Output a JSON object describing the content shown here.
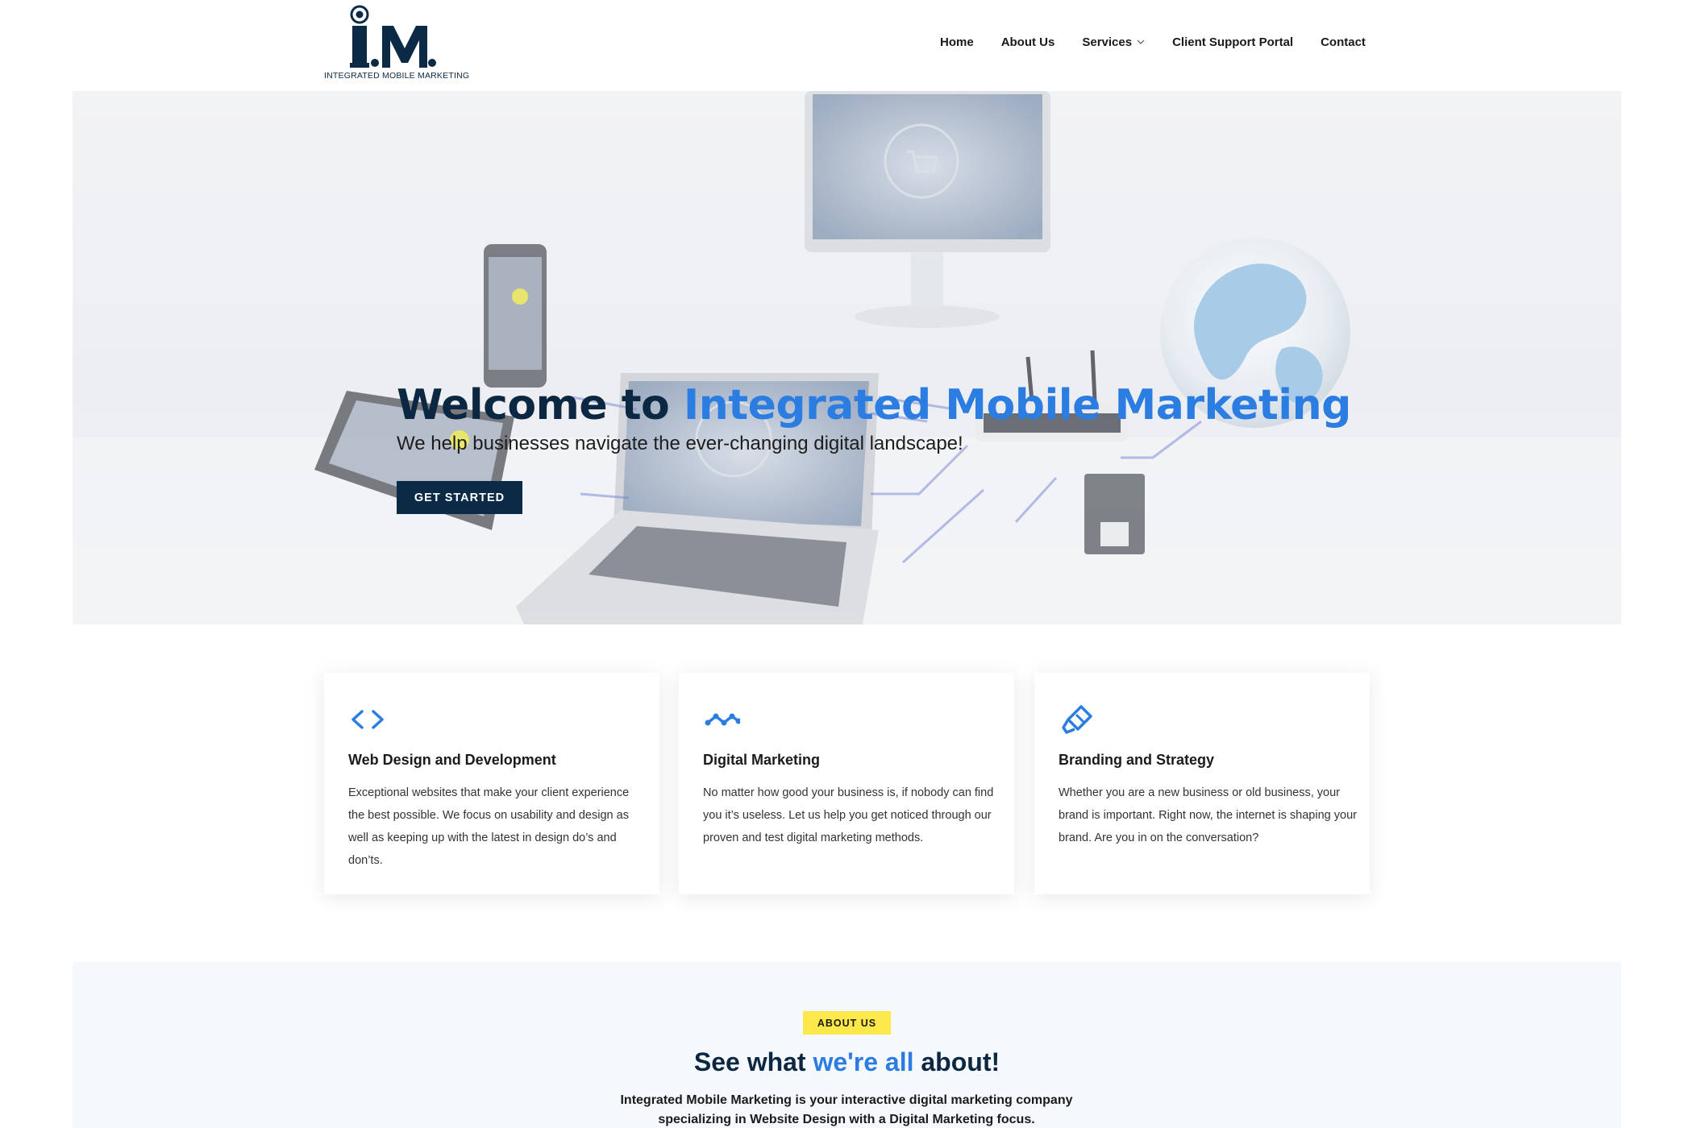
{
  "header": {
    "logo_caption": "INTEGRATED MOBILE MARKETING",
    "logo_letters": "I.M.",
    "nav": [
      {
        "label": "Home"
      },
      {
        "label": "About Us"
      },
      {
        "label": "Services"
      },
      {
        "label": "Client Support Portal"
      },
      {
        "label": "Contact"
      }
    ]
  },
  "hero": {
    "title_prefix": "Welcome to ",
    "title_accent": "Integrated Mobile Marketing",
    "subtitle": "We help businesses navigate the ever-changing digital landscape!",
    "cta_label": "GET STARTED"
  },
  "cards": [
    {
      "icon": "code-icon",
      "title": "Web Design and Development",
      "text": "Exceptional websites that make your client experience the best possible. We focus on usability and design as well as keeping up with the latest in design do’s and don’ts."
    },
    {
      "icon": "trend-wave-icon",
      "title": "Digital Marketing",
      "text": "No matter how good your business is, if nobody can find you it’s useless. Let us help you get noticed through our proven and test digital marketing methods."
    },
    {
      "icon": "paint-brush-icon",
      "title": "Branding and Strategy",
      "text": "Whether you are a new business or old business, your brand is important. Right now, the internet is shaping your brand. Are you in on the conversation?"
    }
  ],
  "about": {
    "badge": "ABOUT US",
    "heading_prefix": "See what ",
    "heading_accent": "we're all",
    "heading_suffix": " about!",
    "text": "Integrated Mobile Marketing is your interactive digital marketing company specializing in Website Design with a Digital Marketing focus."
  },
  "colors": {
    "navy": "#0b2a45",
    "accent_blue": "#2b7de1",
    "badge_yellow": "#fde84a"
  }
}
